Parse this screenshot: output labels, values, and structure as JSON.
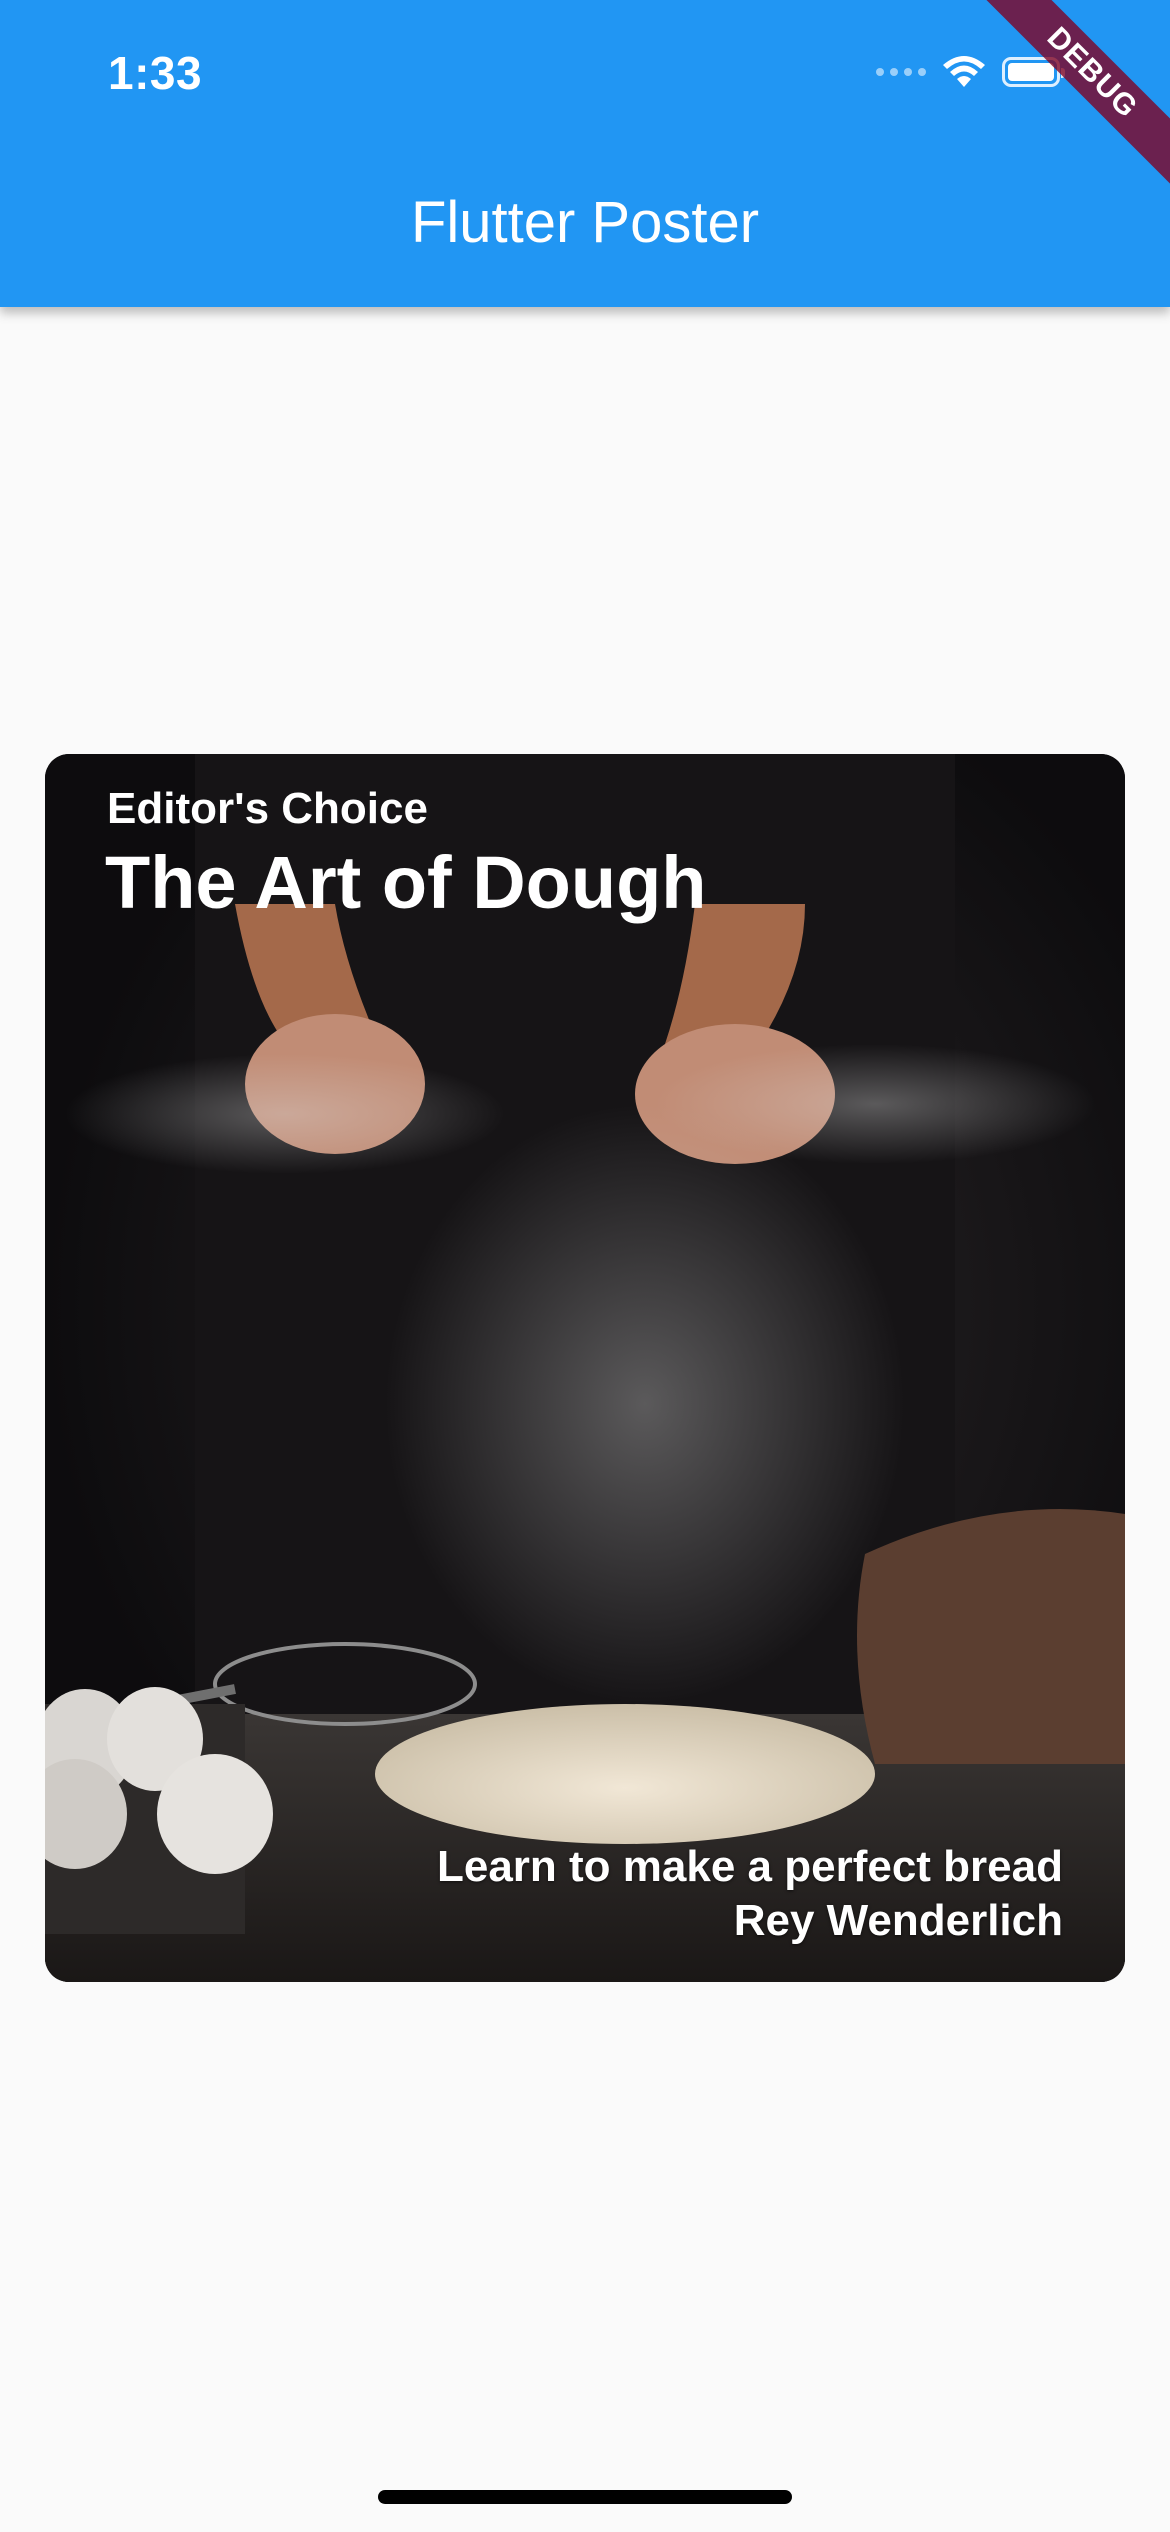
{
  "status_bar": {
    "time": "1:33",
    "icons": [
      "cellular-signal-icon",
      "wifi-icon",
      "battery-icon"
    ]
  },
  "app_bar": {
    "title": "Flutter Poster",
    "color": "#2196f3"
  },
  "debug_banner": {
    "label": "DEBUG"
  },
  "poster": {
    "subtitle": "Editor's Choice",
    "title": "The Art of Dough",
    "description": "Learn to make a perfect bread",
    "author": "Rey Wenderlich"
  }
}
